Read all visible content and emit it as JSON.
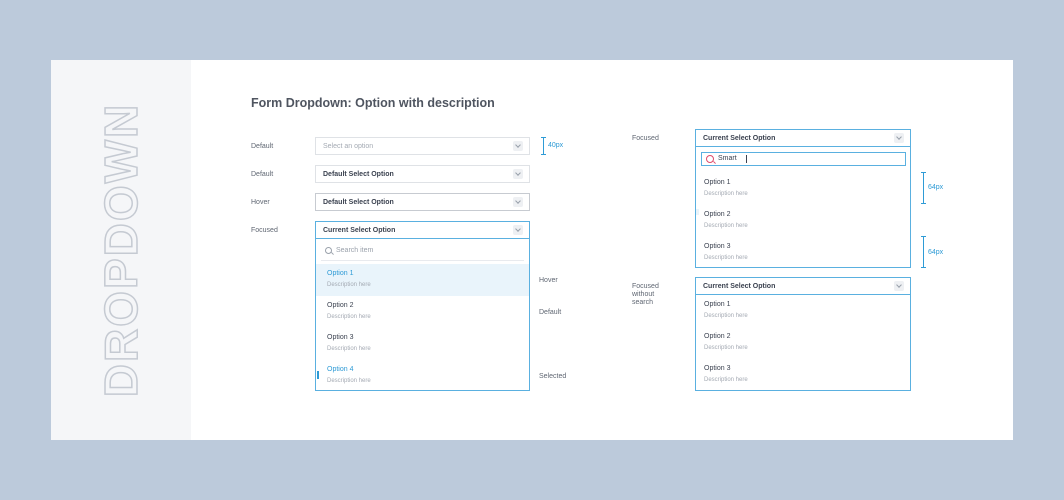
{
  "sidebar": {
    "vertical_title": "DROPDOWN"
  },
  "page": {
    "title": "Form Dropdown: Option with description"
  },
  "left": {
    "rows": [
      {
        "label": "Default",
        "value": "Select an option",
        "placeholder": true
      },
      {
        "label": "Default",
        "value": "Default Select Option"
      },
      {
        "label": "Hover",
        "value": "Default Select Option"
      },
      {
        "label": "Focused",
        "value": "Current Select Option"
      }
    ],
    "search_placeholder": "Search item",
    "options": [
      {
        "title": "Option 1",
        "desc": "Description here",
        "state": "Hover"
      },
      {
        "title": "Option 2",
        "desc": "Description here",
        "state": "Default"
      },
      {
        "title": "Option 3",
        "desc": "Description here",
        "state": ""
      },
      {
        "title": "Option 4",
        "desc": "Description here",
        "state": "Selected"
      }
    ],
    "height_annotation": "40px"
  },
  "right": {
    "focused_label": "Focused",
    "focused_value": "Current Select Option",
    "search_value": "Smart",
    "options": [
      {
        "title": "Option 1",
        "desc": "Description here"
      },
      {
        "title": "Option 2",
        "desc": "Description here"
      },
      {
        "title": "Option 3",
        "desc": "Description here"
      }
    ],
    "annotation_1": "64px",
    "annotation_2": "64px",
    "nosearch_label_1": "Focused",
    "nosearch_label_2": "without",
    "nosearch_label_3": "search",
    "nosearch_value": "Current Select Option",
    "nosearch_options": [
      {
        "title": "Option 1",
        "desc": "Description here"
      },
      {
        "title": "Option 2",
        "desc": "Description here"
      },
      {
        "title": "Option 3",
        "desc": "Description here"
      }
    ]
  },
  "colors": {
    "accent": "#2e9bd6",
    "background": "#bccadb",
    "highlight": "#e9f4fb"
  }
}
